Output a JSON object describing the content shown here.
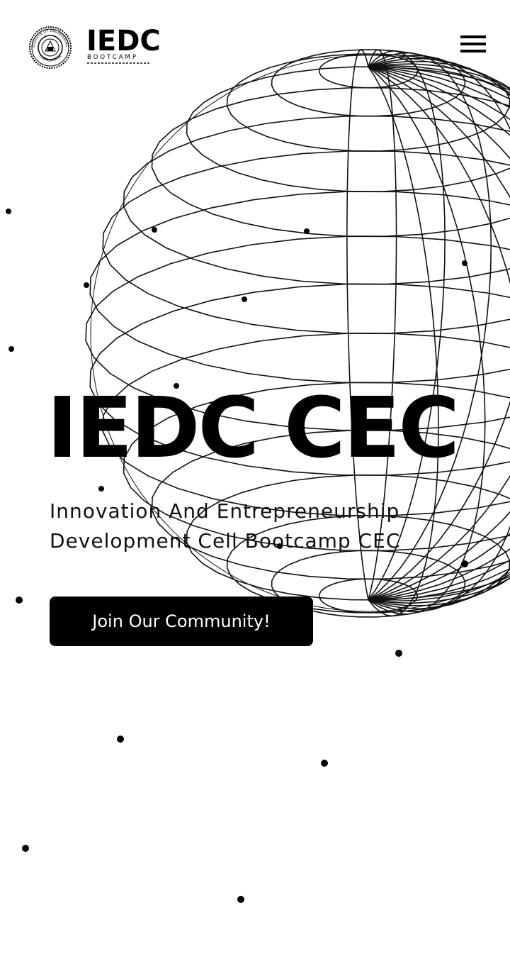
{
  "header": {
    "college_logo": {
      "ring_text_top": "COLLEGE OF ENGINEERING",
      "ring_text_bottom": "CHENGANNUR",
      "icon": "college-seal"
    },
    "brand_logo": {
      "mark": "IEDC",
      "subtitle": "BOOTCAMP"
    },
    "menu": {
      "icon": "hamburger-menu-icon"
    }
  },
  "hero": {
    "title": "IEDC CEC",
    "subtitle_line1": "Innovation And Entrepreneurship",
    "subtitle_line2": "Development Cell Bootcamp CEC",
    "cta_label": "Join Our Community!"
  },
  "background": {
    "graphic": "wireframe-globe",
    "decoration": "scattered-dots"
  },
  "colors": {
    "primary": "#000000",
    "background": "#ffffff",
    "button_text": "#ffffff"
  }
}
